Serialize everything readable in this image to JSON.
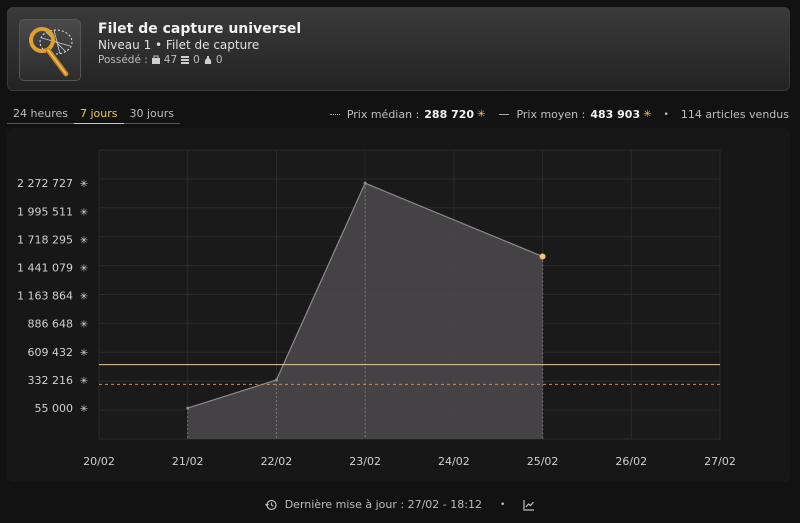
{
  "item": {
    "title": "Filet de capture universel",
    "subtitle": "Niveau 1 • Filet de capture",
    "owned_label": "Possédé :",
    "owned_counts": [
      "47",
      "0",
      "0"
    ]
  },
  "tabs": [
    {
      "label": "24 heures",
      "active": false
    },
    {
      "label": "7 jours",
      "active": true
    },
    {
      "label": "30 jours",
      "active": false
    }
  ],
  "stats": {
    "median_label": "Prix médian :",
    "median_value": "288 720",
    "mean_label": "Prix moyen :",
    "mean_value": "483 903",
    "sold": "114 articles vendus",
    "separator": "•"
  },
  "chart_data": {
    "type": "area",
    "x": [
      "21/02",
      "22/02",
      "23/02",
      "25/02"
    ],
    "values": [
      55000,
      332216,
      2272727,
      1550000
    ],
    "categories": [
      "20/02",
      "21/02",
      "22/02",
      "23/02",
      "24/02",
      "25/02",
      "26/02",
      "27/02"
    ],
    "y_ticks": [
      55000,
      332216,
      609432,
      886648,
      1163864,
      1441079,
      1718295,
      1995511,
      2272727
    ],
    "y_tick_labels": [
      "55 000",
      "332 216",
      "609 432",
      "886 648",
      "1 163 864",
      "1 441 079",
      "1 718 295",
      "1 995 511",
      "2 272 727"
    ],
    "ylim": [
      -250000,
      2600000
    ],
    "median": 288720,
    "mean": 483903,
    "grid": true,
    "colors": {
      "area": "#4c4a4c",
      "line": "#8c8c8c",
      "median": "#c88a50",
      "mean": "#e8c89a",
      "point": "#f4c07a"
    }
  },
  "footer": {
    "updated": "Dernière mise à jour : 27/02 - 18:12",
    "separator": "•"
  }
}
